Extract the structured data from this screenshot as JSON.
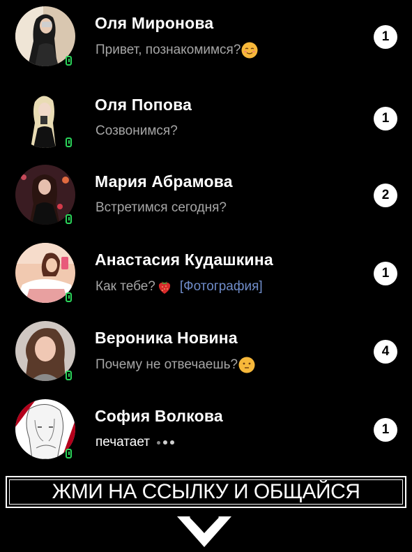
{
  "chats": [
    {
      "name": "Оля Миронова",
      "message": "Привет, познакомимся?",
      "emoji": "relieved-face-emoji",
      "unread": "1"
    },
    {
      "name": "Оля Попова",
      "message": "Созвонимся?",
      "unread": "1"
    },
    {
      "name": "Мария Абрамова",
      "message": "Встретимся сегодня?",
      "unread": "2"
    },
    {
      "name": "Анастасия Кудашкина",
      "message": "Как тебе?",
      "emoji": "strawberry-emoji",
      "attachment": "[Фотография]",
      "unread": "1"
    },
    {
      "name": "Вероника Новина",
      "message": "Почему не отвечаешь?",
      "emoji": "flushed-face-emoji",
      "unread": "4"
    },
    {
      "name": "София Волкова",
      "message": "печатает",
      "typing": true,
      "unread": "1"
    }
  ],
  "cta": {
    "text": "ЖМИ НА ССЫЛКУ И ОБЩАЙСЯ"
  },
  "colors": {
    "background": "#000000",
    "online": "#2bd45a",
    "message_text": "#a6a6a6",
    "attachment_link": "#6f8cc9"
  }
}
